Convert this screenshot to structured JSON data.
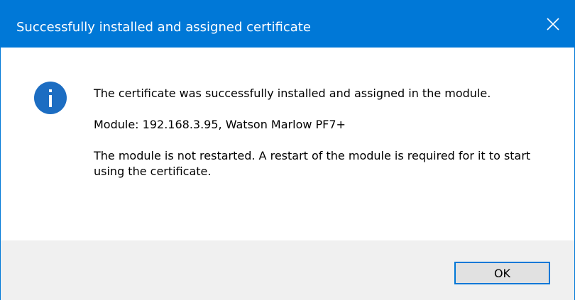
{
  "window": {
    "title": "Successfully installed and assigned certificate",
    "close_icon": "close-icon",
    "accent_color": "#0078d7"
  },
  "content": {
    "icon": "info-icon",
    "messages": [
      "The certificate was successfully installed and assigned in the module.",
      "Module: 192.168.3.95, Watson Marlow PF7+",
      "The module is not restarted. A restart of the module is required for it to start using the certificate."
    ]
  },
  "footer": {
    "ok_label": "OK"
  }
}
